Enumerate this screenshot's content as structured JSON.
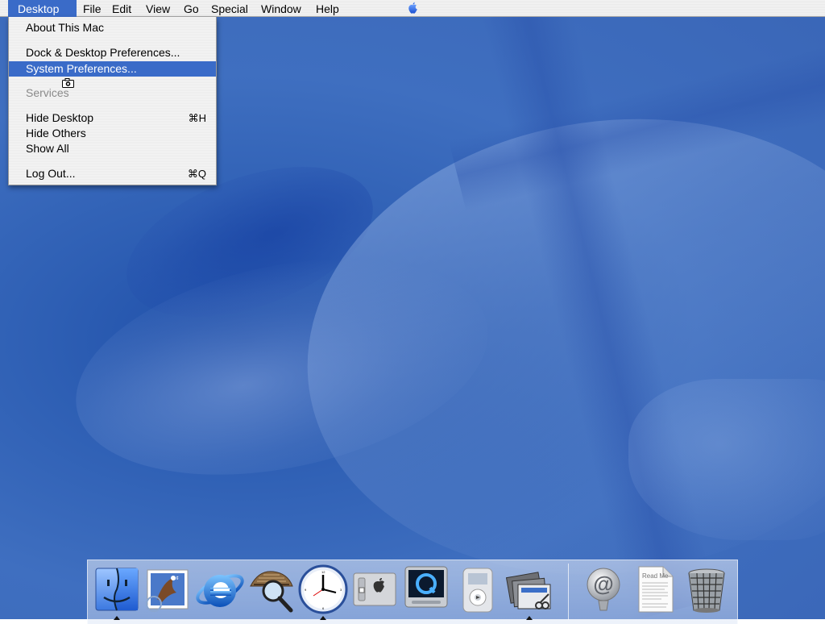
{
  "menubar": {
    "items": [
      "Desktop",
      "File",
      "Edit",
      "View",
      "Go",
      "Special",
      "Window",
      "Help"
    ],
    "active_item": "Desktop",
    "logo_icon": "apple-logo",
    "accent_color": "#3a6bc8"
  },
  "desktop_menu": {
    "items": [
      {
        "label": "About This Mac",
        "shortcut": "",
        "state": "normal"
      },
      {
        "label": "Dock & Desktop Preferences...",
        "shortcut": "",
        "state": "normal"
      },
      {
        "label": "System Preferences...",
        "shortcut": "",
        "state": "highlighted"
      },
      {
        "label": "Services",
        "shortcut": "",
        "state": "disabled"
      },
      {
        "label": "Hide Desktop",
        "shortcut": "⌘H",
        "state": "normal"
      },
      {
        "label": "Hide Others",
        "shortcut": "",
        "state": "normal"
      },
      {
        "label": "Show All",
        "shortcut": "",
        "state": "normal"
      },
      {
        "label": "Log Out...",
        "shortcut": "⌘Q",
        "state": "normal"
      }
    ],
    "cursor_icon": "camera-cursor-icon"
  },
  "dock": {
    "apps": [
      {
        "name": "finder-icon",
        "running": true
      },
      {
        "name": "mail-icon",
        "running": false
      },
      {
        "name": "internet-explorer-icon",
        "running": false
      },
      {
        "name": "sherlock-icon",
        "running": false
      },
      {
        "name": "clock-icon",
        "running": true
      },
      {
        "name": "system-preferences-icon",
        "running": false
      },
      {
        "name": "quicktime-player-icon",
        "running": false
      },
      {
        "name": "itunes-icon",
        "running": false
      },
      {
        "name": "grab-icon",
        "running": true
      }
    ],
    "documents": [
      {
        "name": "internet-location-icon"
      },
      {
        "name": "read-me-document-icon",
        "label": "Read Me"
      },
      {
        "name": "trash-icon"
      }
    ]
  }
}
